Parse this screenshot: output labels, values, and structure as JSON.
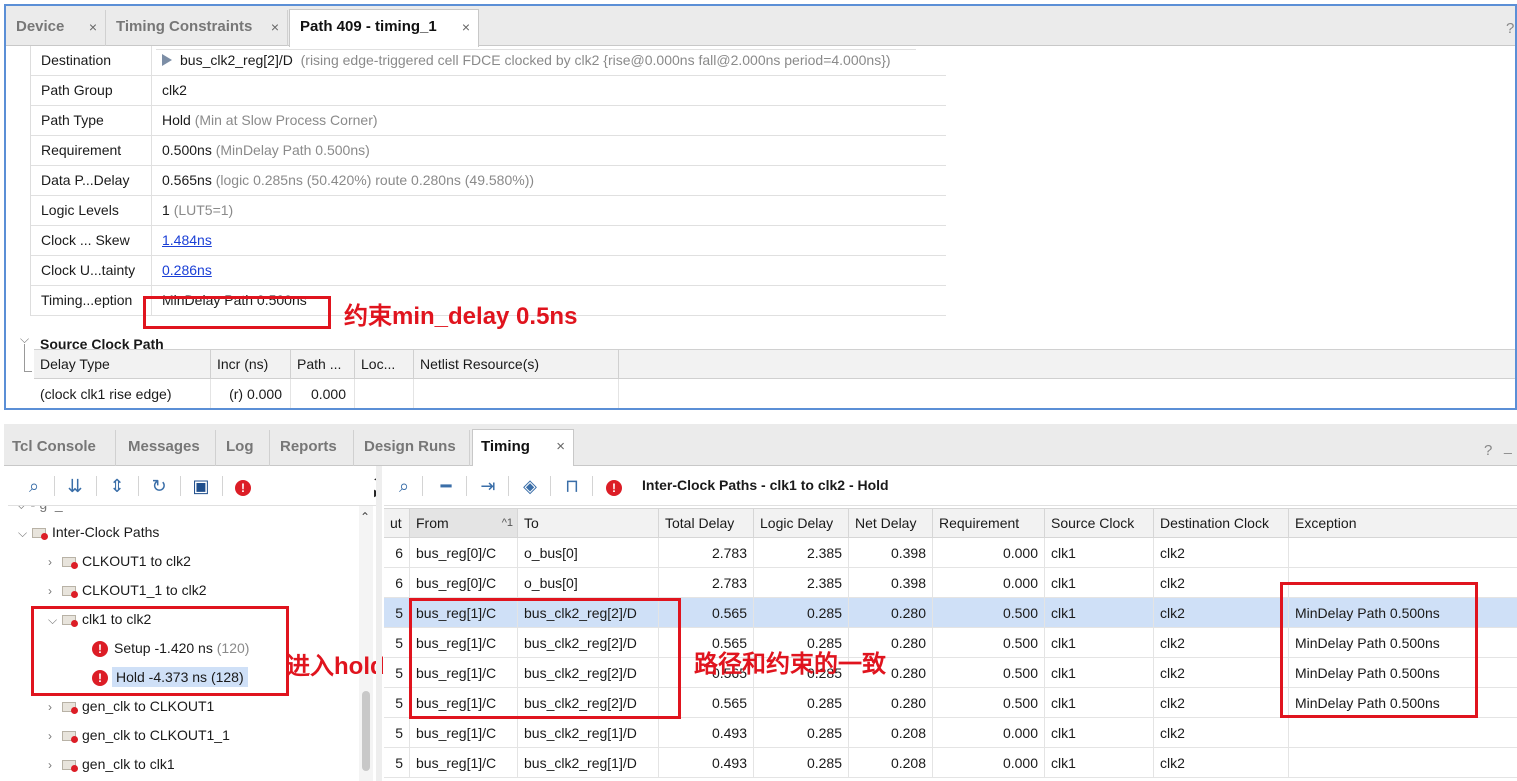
{
  "top_tabs": [
    {
      "label": "Device"
    },
    {
      "label": "Timing Constraints"
    },
    {
      "label": "Path 409 - timing_1",
      "active": true
    }
  ],
  "help_glyph": "?",
  "properties": [
    {
      "key": "Destination",
      "value": "bus_clk2_reg[2]/D",
      "detail": "(rising edge-triggered cell FDCE clocked by clk2  {rise@0.000ns fall@2.000ns period=4.000ns})"
    },
    {
      "key": "Path Group",
      "value": "clk2",
      "detail": ""
    },
    {
      "key": "Path Type",
      "value": "Hold",
      "detail": "(Min at Slow Process Corner)"
    },
    {
      "key": "Requirement",
      "value": "0.500ns",
      "detail": "(MinDelay Path 0.500ns)"
    },
    {
      "key": "Data P...Delay",
      "value": "0.565ns",
      "detail": "(logic 0.285ns (50.420%)  route 0.280ns (49.580%))"
    },
    {
      "key": "Logic Levels",
      "value": "1",
      "detail": " (LUT5=1)"
    },
    {
      "key": "Clock ... Skew",
      "value": "1.484ns",
      "detail": ""
    },
    {
      "key": "Clock U...tainty",
      "value": "0.286ns",
      "detail": ""
    },
    {
      "key": "Timing...eption",
      "value": "MinDelay Path 0.500ns",
      "detail": ""
    }
  ],
  "annotations": {
    "constraint": "约束min_delay 0.5ns",
    "enter_hold": "进入hold",
    "path_matches": "路径和约束的一致"
  },
  "source_clock_path": {
    "title": "Source Clock Path",
    "headers": [
      "Delay Type",
      "Incr (ns)",
      "Path ...",
      "Loc...",
      "Netlist Resource(s)"
    ],
    "row": [
      "(clock clk1 rise edge)",
      "(r) 0.000",
      "0.000",
      "",
      ""
    ]
  },
  "bottom_tabs": [
    {
      "label": "Tcl Console"
    },
    {
      "label": "Messages"
    },
    {
      "label": "Log"
    },
    {
      "label": "Reports"
    },
    {
      "label": "Design Runs"
    },
    {
      "label": "Timing",
      "active": true
    }
  ],
  "table_title": "Inter-Clock Paths - clk1 to clk2 - Hold",
  "tree": {
    "root": "Inter-Clock Paths",
    "items": [
      {
        "label": "CLKOUT1 to clk2"
      },
      {
        "label": "CLKOUT1_1 to clk2"
      },
      {
        "label": "clk1 to clk2"
      },
      {
        "label": "Setup -1.420 ns",
        "count": "(120)"
      },
      {
        "label": "Hold -4.373 ns (128)"
      },
      {
        "label": "gen_clk to CLKOUT1"
      },
      {
        "label": "gen_clk to CLKOUT1_1"
      },
      {
        "label": "gen_clk to clk1"
      }
    ]
  },
  "timing_table": {
    "headers": [
      "ut",
      "From",
      "To",
      "Total Delay",
      "Logic Delay",
      "Net Delay",
      "Requirement",
      "Source Clock",
      "Destination Clock",
      "Exception"
    ],
    "sort_indicator": "^1",
    "rows": [
      [
        "6",
        "bus_reg[0]/C",
        "o_bus[0]",
        "2.783",
        "2.385",
        "0.398",
        "0.000",
        "clk1",
        "clk2",
        ""
      ],
      [
        "6",
        "bus_reg[0]/C",
        "o_bus[0]",
        "2.783",
        "2.385",
        "0.398",
        "0.000",
        "clk1",
        "clk2",
        ""
      ],
      [
        "5",
        "bus_reg[1]/C",
        "bus_clk2_reg[2]/D",
        "0.565",
        "0.285",
        "0.280",
        "0.500",
        "clk1",
        "clk2",
        "MinDelay Path 0.500ns"
      ],
      [
        "5",
        "bus_reg[1]/C",
        "bus_clk2_reg[2]/D",
        "0.565",
        "0.285",
        "0.280",
        "0.500",
        "clk1",
        "clk2",
        "MinDelay Path 0.500ns"
      ],
      [
        "5",
        "bus_reg[1]/C",
        "bus_clk2_reg[2]/D",
        "0.565",
        "0.285",
        "0.280",
        "0.500",
        "clk1",
        "clk2",
        "MinDelay Path 0.500ns"
      ],
      [
        "5",
        "bus_reg[1]/C",
        "bus_clk2_reg[2]/D",
        "0.565",
        "0.285",
        "0.280",
        "0.500",
        "clk1",
        "clk2",
        "MinDelay Path 0.500ns"
      ],
      [
        "5",
        "bus_reg[1]/C",
        "bus_clk2_reg[1]/D",
        "0.493",
        "0.285",
        "0.208",
        "0.000",
        "clk1",
        "clk2",
        ""
      ],
      [
        "5",
        "bus_reg[1]/C",
        "bus_clk2_reg[1]/D",
        "0.493",
        "0.285",
        "0.208",
        "0.000",
        "clk1",
        "clk2",
        ""
      ]
    ]
  },
  "colors": {
    "annotation": "#e0141e",
    "accent": "#5b8fd6",
    "selection": "#cfe0f7",
    "error": "#dc1d26"
  }
}
